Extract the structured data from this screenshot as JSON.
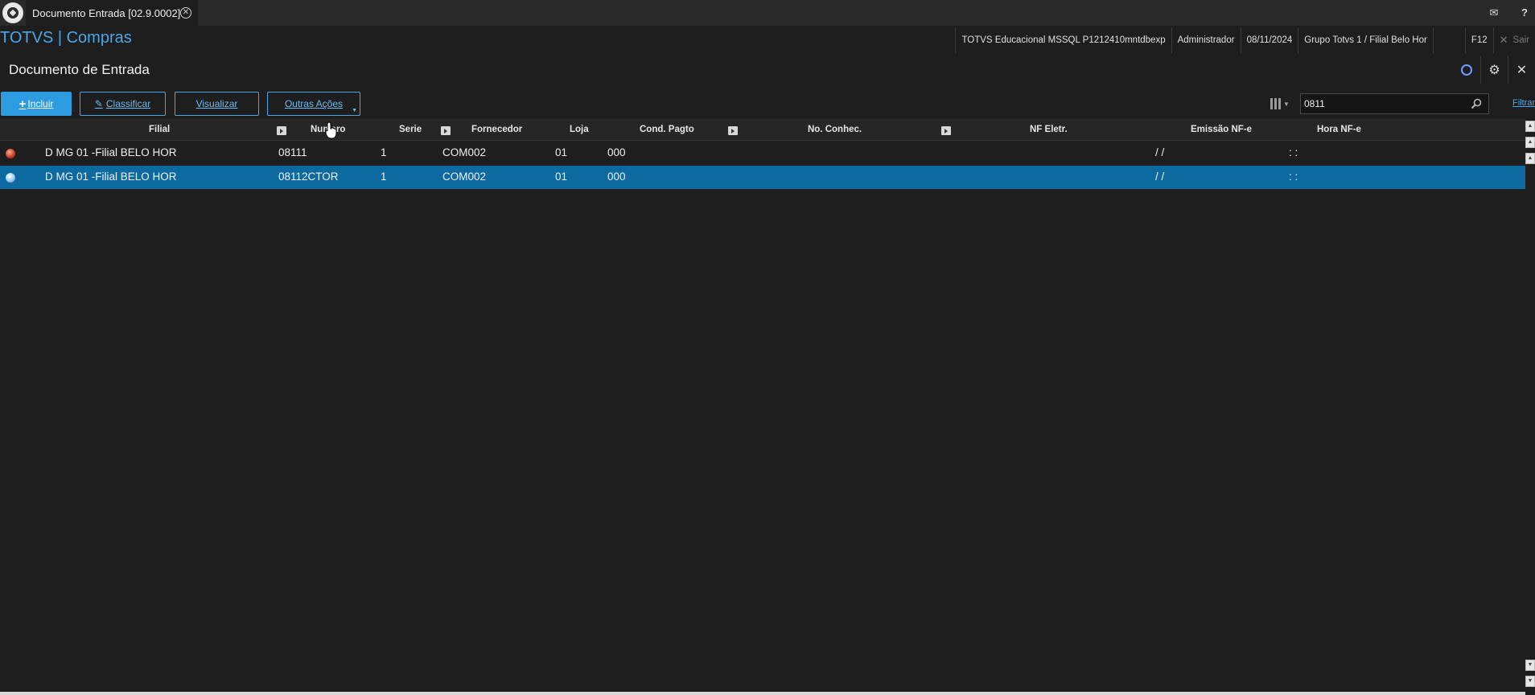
{
  "tab": {
    "title": "Documento Entrada [02.9.0002]",
    "close_glyph": "✕"
  },
  "topbar": {
    "mail_glyph": "✉",
    "help_glyph": "?"
  },
  "brand": "TOTVS | Compras",
  "env": {
    "database": "TOTVS Educacional MSSQL P1212410mntdbexp",
    "user": "Administrador",
    "date": "08/11/2024",
    "branch": "Grupo Totvs 1 / Filial Belo Hor",
    "shortcut": "F12",
    "exit_label": "Sair",
    "exit_glyph": "✕"
  },
  "page": {
    "title": "Documento de Entrada",
    "close_glyph": "✕",
    "settings_glyph": "⚙"
  },
  "toolbar": {
    "incluir": "Incluir",
    "classificar": "Classificar",
    "visualizar": "Visualizar",
    "outras_acoes": "Outras Ações"
  },
  "search": {
    "value": "0811",
    "placeholder": "",
    "filter_label": "Filtrar"
  },
  "grid": {
    "columns": {
      "filial": "Filial",
      "numero": "Numero",
      "serie": "Serie",
      "fornecedor": "Fornecedor",
      "loja": "Loja",
      "cond_pagto": "Cond. Pagto",
      "no_conhec": "No. Conhec.",
      "nf_eletr": "NF Eletr.",
      "emissao_nfe": "Emissão NF-e",
      "hora_nfe": "Hora NF-e"
    },
    "rows": [
      {
        "status": "red",
        "filial": "D MG 01 -Filial BELO HOR",
        "numero": "08111",
        "serie": "1",
        "fornecedor": "COM002",
        "loja": "01",
        "cond_pagto": "000",
        "emissao": "/ /",
        "hora": ": :"
      },
      {
        "status": "blue",
        "filial": "D MG 01 -Filial BELO HOR",
        "numero": "08112CTOR",
        "serie": "1",
        "fornecedor": "COM002",
        "loja": "01",
        "cond_pagto": "000",
        "emissao": "/ /",
        "hora": ": :"
      }
    ]
  },
  "colors": {
    "accent": "#2d9be0",
    "brand": "#4aa8e8",
    "selected_row": "#0d6aa0",
    "background": "#1e1e1e"
  }
}
